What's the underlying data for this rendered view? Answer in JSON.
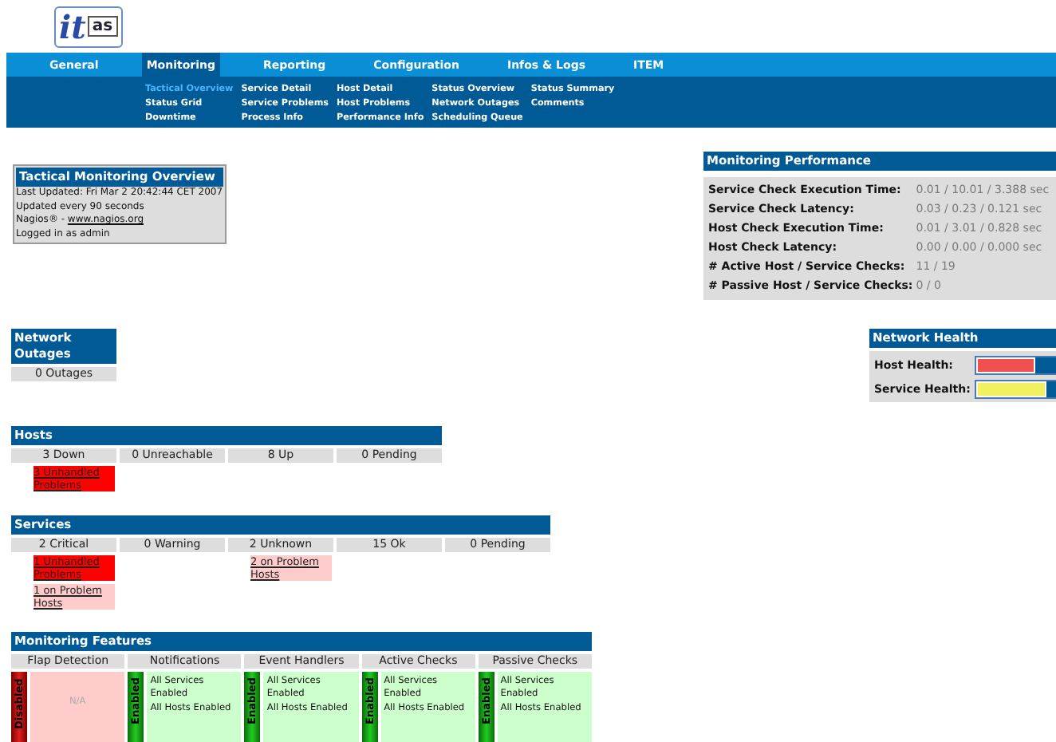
{
  "logo": {
    "main": "it",
    "boxed": "as"
  },
  "nav": {
    "tabs": [
      {
        "label": "General",
        "selected": false
      },
      {
        "label": "Monitoring",
        "selected": true
      },
      {
        "label": "Reporting",
        "selected": false
      },
      {
        "label": "Configuration",
        "selected": false
      },
      {
        "label": "Infos & Logs",
        "selected": false
      },
      {
        "label": "ITEM",
        "selected": false
      }
    ],
    "submenu": [
      [
        {
          "label": "Tactical Overview",
          "selected": true
        },
        {
          "label": "Status Grid",
          "selected": false
        },
        {
          "label": "Downtime",
          "selected": false
        }
      ],
      [
        {
          "label": "Service Detail",
          "selected": false
        },
        {
          "label": "Service Problems",
          "selected": false
        },
        {
          "label": "Process Info",
          "selected": false
        }
      ],
      [
        {
          "label": "Host Detail",
          "selected": false
        },
        {
          "label": "Host Problems",
          "selected": false
        },
        {
          "label": "Performance Info",
          "selected": false
        }
      ],
      [
        {
          "label": "Status Overview",
          "selected": false
        },
        {
          "label": "Network Outages",
          "selected": false
        },
        {
          "label": "Scheduling Queue",
          "selected": false
        }
      ],
      [
        {
          "label": "Status Summary",
          "selected": false
        },
        {
          "label": "Comments",
          "selected": false
        }
      ]
    ]
  },
  "overview": {
    "title": "Tactical Monitoring Overview",
    "lines": [
      "Last Updated: Fri Mar 2 20:42:44 CET 2007",
      "Updated every 90 seconds"
    ],
    "credit": "Nagios® - ",
    "link": "www.nagios.org",
    "login": "Logged in as admin"
  },
  "performance": {
    "title": "Monitoring Performance",
    "rows": [
      {
        "label": "Service Check Execution Time:",
        "value": "0.01 / 10.01 / 3.388 sec"
      },
      {
        "label": "Service Check Latency:",
        "value": "0.03 / 0.23 / 0.121 sec"
      },
      {
        "label": "Host Check Execution Time:",
        "value": "0.01 / 3.01 / 0.828 sec"
      },
      {
        "label": "Host Check Latency:",
        "value": "0.00 / 0.00 / 0.000 sec"
      },
      {
        "label": "# Active Host / Service Checks:",
        "value": "11 / 19"
      },
      {
        "label": "# Passive Host / Service Checks:",
        "value": "0 / 0"
      }
    ]
  },
  "outages": {
    "title": "Network Outages",
    "value": "0 Outages"
  },
  "health": {
    "title": "Network Health",
    "bars": [
      {
        "label": "Host Health:",
        "level": 0.73,
        "color": "#f05050"
      },
      {
        "label": "Service Health:",
        "level": 0.88,
        "color": "#f0f060"
      }
    ]
  },
  "hosts": {
    "title": "Hosts",
    "columns": [
      {
        "label": "3 Down",
        "problems": [
          {
            "kind": "unhandled",
            "text": "3 Unhandled Problems"
          }
        ]
      },
      {
        "label": "0 Unreachable"
      },
      {
        "label": "8 Up"
      },
      {
        "label": "0 Pending"
      }
    ]
  },
  "services": {
    "title": "Services",
    "columns": [
      {
        "label": "2 Critical",
        "problems": [
          {
            "kind": "unhandled",
            "text": "1 Unhandled Problems"
          },
          {
            "kind": "on_problem_host",
            "text": "1 on Problem Hosts"
          }
        ]
      },
      {
        "label": "0 Warning"
      },
      {
        "label": "2 Unknown",
        "problems": [
          {
            "kind": "on_problem_host",
            "text": "2 on Problem Hosts"
          }
        ]
      },
      {
        "label": "15 Ok"
      },
      {
        "label": "0 Pending"
      }
    ]
  },
  "features": {
    "title": "Monitoring Features",
    "columns": [
      {
        "label": "Flap Detection",
        "enabled": false,
        "status": "Disabled",
        "lines": [
          "N/A"
        ]
      },
      {
        "label": "Notifications",
        "enabled": true,
        "status": "Enabled",
        "lines": [
          "All Services Enabled",
          "All Hosts Enabled"
        ]
      },
      {
        "label": "Event Handlers",
        "enabled": true,
        "status": "Enabled",
        "lines": [
          "All Services Enabled",
          "All Hosts Enabled"
        ]
      },
      {
        "label": "Active Checks",
        "enabled": true,
        "status": "Enabled",
        "lines": [
          "All Services Enabled",
          "All Hosts Enabled"
        ]
      },
      {
        "label": "Passive Checks",
        "enabled": true,
        "status": "Enabled",
        "lines": [
          "All Services Enabled",
          "All Hosts Enabled"
        ]
      }
    ]
  }
}
